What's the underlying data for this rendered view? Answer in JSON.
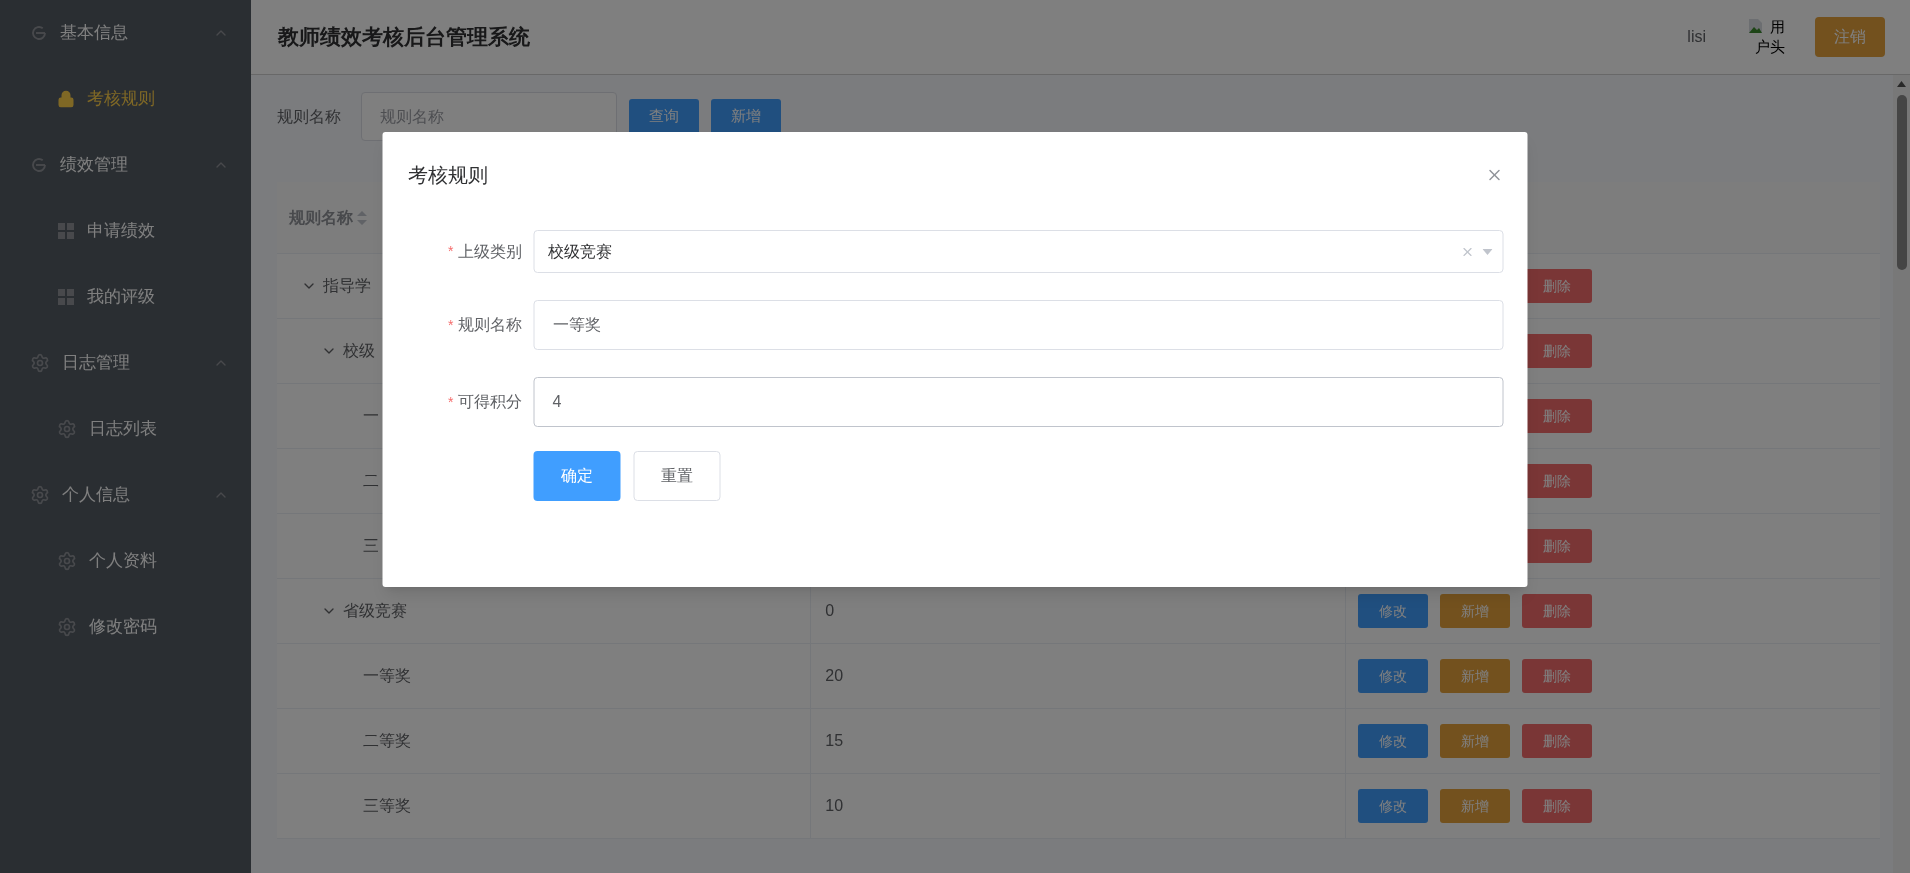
{
  "sidebar": {
    "groups": [
      {
        "label": "基本信息",
        "kind": "refresh",
        "expanded": true,
        "items": [
          {
            "label": "考核规则",
            "kind": "lock",
            "selected": true
          }
        ]
      },
      {
        "label": "绩效管理",
        "kind": "refresh",
        "expanded": true,
        "items": [
          {
            "label": "申请绩效",
            "kind": "grid",
            "selected": false
          },
          {
            "label": "我的评级",
            "kind": "grid",
            "selected": false
          }
        ]
      },
      {
        "label": "日志管理",
        "kind": "gear",
        "expanded": true,
        "items": [
          {
            "label": "日志列表",
            "kind": "gear",
            "selected": false
          }
        ]
      },
      {
        "label": "个人信息",
        "kind": "gear",
        "expanded": true,
        "items": [
          {
            "label": "个人资料",
            "kind": "gear",
            "selected": false
          },
          {
            "label": "修改密码",
            "kind": "gear",
            "selected": false
          }
        ]
      }
    ]
  },
  "header": {
    "title": "教师绩效考核后台管理系统",
    "username": "lisi",
    "avatar_alt_lines": [
      "用",
      "户头"
    ],
    "logout_button": "注销"
  },
  "search": {
    "label": "规则名称",
    "placeholder": "规则名称",
    "buttons": [
      {
        "label": "查询"
      },
      {
        "label": "新增"
      }
    ]
  },
  "table": {
    "columns": [
      {
        "label": "规则名称",
        "sortable": true
      }
    ],
    "rows": [
      {
        "name": "指导学",
        "expanded": true,
        "actions": [
          {
            "label": "删除",
            "kind": "delete"
          }
        ],
        "children": [
          {
            "name": "校级",
            "expanded": true,
            "actions": [
              {
                "label": "删除",
                "kind": "delete"
              }
            ],
            "children": [
              {
                "name": "一",
                "actions": [
                  {
                    "label": "删除",
                    "kind": "delete"
                  }
                ]
              },
              {
                "name": "二",
                "actions": [
                  {
                    "label": "删除",
                    "kind": "delete"
                  }
                ]
              },
              {
                "name": "三",
                "actions": [
                  {
                    "label": "删除",
                    "kind": "delete"
                  }
                ]
              }
            ]
          },
          {
            "name": "省级竞赛",
            "value": "0",
            "expanded": true,
            "actions": [
              {
                "label": "修改",
                "kind": "edit"
              },
              {
                "label": "新增",
                "kind": "add"
              },
              {
                "label": "删除",
                "kind": "delete"
              }
            ],
            "children": [
              {
                "name": "一等奖",
                "value": "20",
                "actions": [
                  {
                    "label": "修改",
                    "kind": "edit"
                  },
                  {
                    "label": "新增",
                    "kind": "add"
                  },
                  {
                    "label": "删除",
                    "kind": "delete"
                  }
                ]
              },
              {
                "name": "二等奖",
                "value": "15",
                "actions": [
                  {
                    "label": "修改",
                    "kind": "edit"
                  },
                  {
                    "label": "新增",
                    "kind": "add"
                  },
                  {
                    "label": "删除",
                    "kind": "delete"
                  }
                ]
              },
              {
                "name": "三等奖",
                "value": "10",
                "actions": [
                  {
                    "label": "修改",
                    "kind": "edit"
                  },
                  {
                    "label": "新增",
                    "kind": "add"
                  },
                  {
                    "label": "删除",
                    "kind": "delete"
                  }
                ]
              }
            ]
          }
        ]
      }
    ]
  },
  "dialog": {
    "title": "考核规则",
    "fields": [
      {
        "label": "上级类别",
        "required_mark": "*",
        "kind": "select",
        "value": "校级竞赛",
        "clearable": true,
        "focused": false
      },
      {
        "label": "规则名称",
        "required_mark": "*",
        "kind": "text",
        "value": "一等奖",
        "focused": false
      },
      {
        "label": "可得积分",
        "required_mark": "*",
        "kind": "text",
        "value": "4",
        "focused": true
      }
    ],
    "buttons": [
      {
        "label": "确定",
        "kind": "primary"
      },
      {
        "label": "重置",
        "kind": "default"
      }
    ]
  }
}
